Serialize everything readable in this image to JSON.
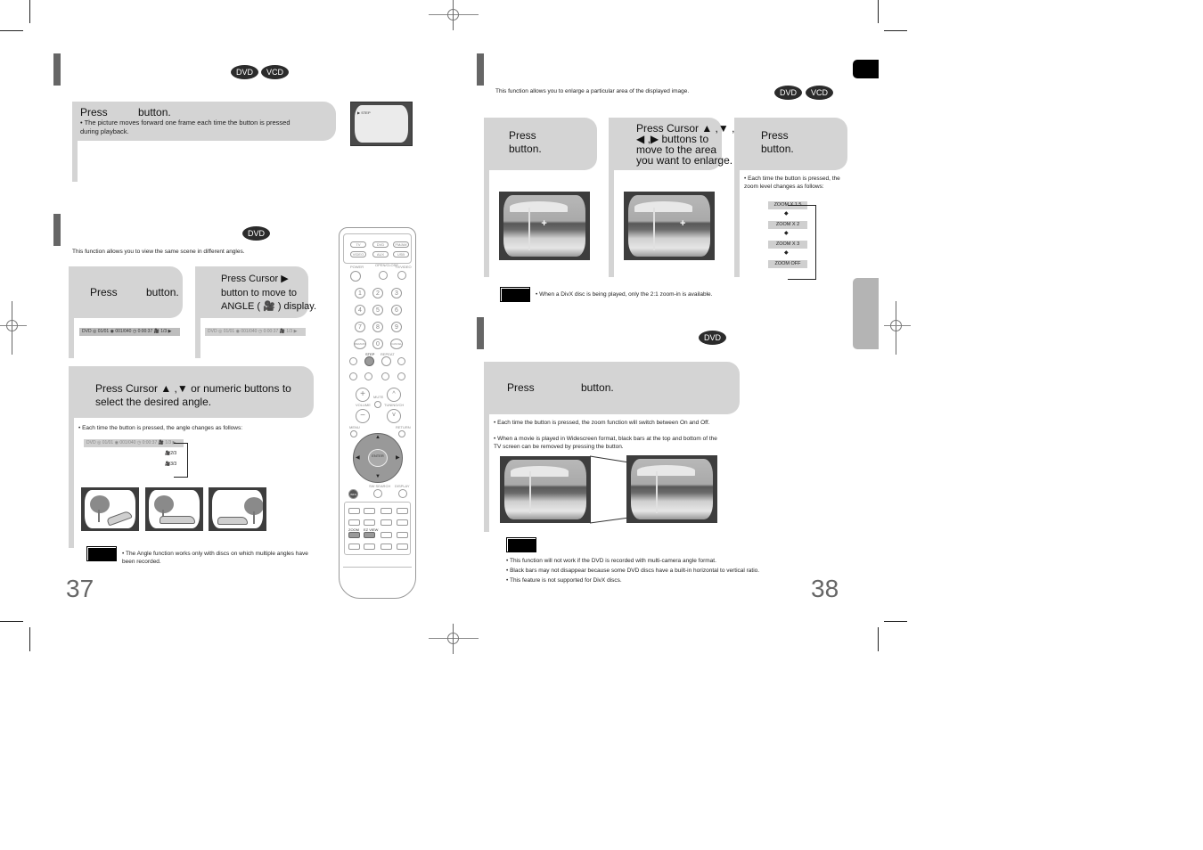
{
  "left_page": {
    "page_number": "37",
    "step_section": {
      "badges": [
        "DVD",
        "VCD"
      ],
      "step1": {
        "prefix": "Press",
        "suffix": "button."
      },
      "bullet": "The picture moves forward one frame each time the button is pressed during playback.",
      "tv_osd": "▶ STEP"
    },
    "angle_section": {
      "badges": [
        "DVD"
      ],
      "intro": "This function allows you to view the same scene in different angles.",
      "step1": {
        "prefix": "Press",
        "suffix": "button."
      },
      "step2": {
        "line1": "Press Cursor ▶",
        "line2": "button to move to",
        "line3": "ANGLE ( 🎥 ) display."
      },
      "osd_bar": "DVD  ◎ 01/01   ◉ 001/040   ◷ 0:00:37   🎥 1/3 ▶",
      "step3": {
        "line1": "Press Cursor  ▲ ,▼  or numeric buttons to",
        "line2": "select the desired angle."
      },
      "bullet": "Each time the button is pressed, the angle changes as follows:",
      "angle_cycle": [
        "1/3",
        "2/3",
        "3/3"
      ],
      "note": "The Angle function works only with discs on which multiple angles have been recorded."
    }
  },
  "remote": {
    "top_buttons": [
      "TV",
      "DVD",
      "FM/AM",
      "VIDEO",
      "AUX",
      "USB"
    ],
    "labels": {
      "power": "POWER",
      "open_close": "OPEN/CLOSE",
      "tv_video": "TV/VIDEO",
      "step": "STEP",
      "repeat": "REPEAT",
      "volume": "VOLUME",
      "mute": "MUTE",
      "tuning": "TUNING/CH",
      "menu": "MENU",
      "return": "RETURN",
      "enter": "ENTER",
      "info": "INFO",
      "sw_search": "SW SEARCH",
      "display": "DISPLAY",
      "zoom": "ZOOM",
      "ez_view": "EZ VIEW"
    },
    "numbers": [
      "1",
      "2",
      "3",
      "4",
      "5",
      "6",
      "7",
      "8",
      "9",
      "REMAIN",
      "0",
      "CANCEL"
    ]
  },
  "right_page": {
    "page_number": "38",
    "zoom_section": {
      "badges": [
        "DVD",
        "VCD"
      ],
      "intro": "This function allows you to enlarge a particular area of the displayed image.",
      "step1": {
        "line1": "Press",
        "line2": "button."
      },
      "step2": {
        "line1": "Press Cursor ▲ ,▼ ,",
        "line2": "◀ ,▶ buttons to",
        "line3": "move to the area",
        "line4": "you want to enlarge."
      },
      "step3": {
        "line1": "Press",
        "line2": "button."
      },
      "bullet": "Each time the button is pressed, the zoom level changes as follows:",
      "zoom_levels": [
        "ZOOM X 1.5",
        "ZOOM X 2",
        "ZOOM X 3",
        "ZOOM OFF"
      ],
      "note": "When a DivX disc is being played, only the 2:1 zoom-in is available."
    },
    "ezview_section": {
      "badges": [
        "DVD"
      ],
      "step1": {
        "prefix": "Press",
        "suffix": "button."
      },
      "bullets": [
        "Each time the button is pressed, the zoom function will switch between On and Off.",
        "When a movie is played in Widescreen format, black bars at the top and bottom of the TV screen can be removed by pressing the            button."
      ],
      "notes": [
        "This function will not work if the DVD is recorded with multi-camera angle format.",
        "Black bars may not disappear because some DVD discs have a built-in horizontal to vertical ratio.",
        "This feature is not supported for DivX discs."
      ]
    }
  },
  "colors": {
    "step_box": "#d4d4d4",
    "badge": "#2b2b2b",
    "section_bar": "#666666",
    "side_tab_gray": "#b4b4b4"
  }
}
